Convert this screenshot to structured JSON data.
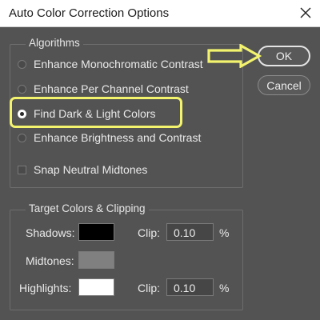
{
  "window": {
    "title": "Auto Color Correction Options"
  },
  "algorithms": {
    "legend": "Algorithms",
    "options": [
      {
        "label": "Enhance Monochromatic Contrast",
        "selected": false
      },
      {
        "label": "Enhance Per Channel Contrast",
        "selected": false
      },
      {
        "label": "Find Dark & Light Colors",
        "selected": true
      },
      {
        "label": "Enhance Brightness and Contrast",
        "selected": false
      }
    ],
    "snap_neutral": {
      "label": "Snap Neutral Midtones",
      "checked": false
    }
  },
  "targets": {
    "legend": "Target Colors & Clipping",
    "shadows": {
      "label": "Shadows:",
      "color": "#000000",
      "clip_label": "Clip:",
      "clip_value": "0.10",
      "unit": "%"
    },
    "midtones": {
      "label": "Midtones:",
      "color": "#808080"
    },
    "highlights": {
      "label": "Highlights:",
      "color": "#ffffff",
      "clip_label": "Clip:",
      "clip_value": "0.10",
      "unit": "%"
    }
  },
  "buttons": {
    "ok": "OK",
    "cancel": "Cancel"
  },
  "annotation_color": "#f3f36e",
  "icons": {
    "close": "close-icon",
    "pointer": "arrow-right-icon"
  }
}
